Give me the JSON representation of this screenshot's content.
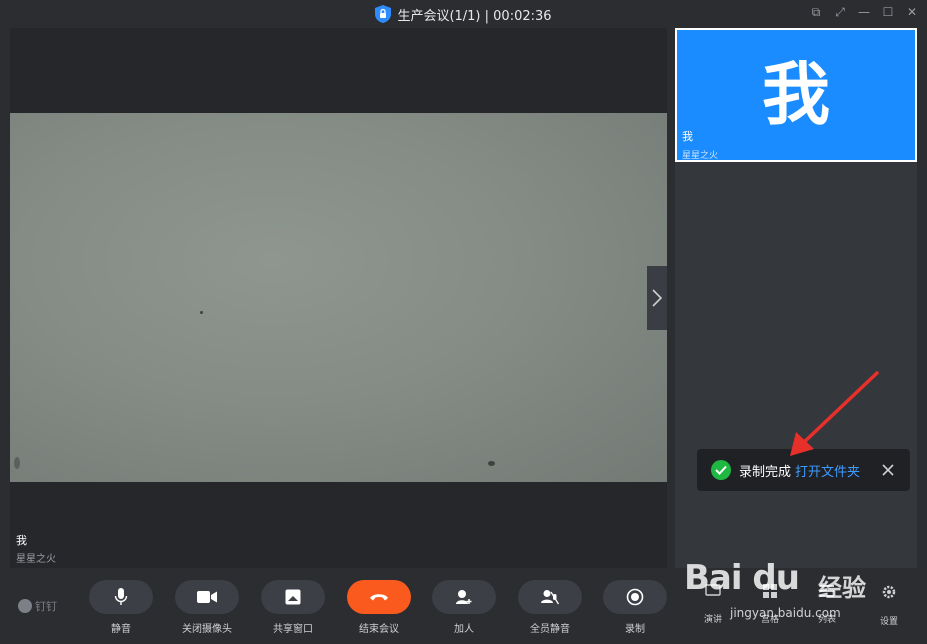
{
  "window": {
    "title": "生产会议(1/1) | 00:02:36",
    "controls": [
      "⧉",
      "⤢",
      "—",
      "☐",
      "✕"
    ]
  },
  "main_video": {
    "participant_name": "我",
    "participant_sub": "星星之火"
  },
  "side_panel": {
    "tile_avatar_text": "我",
    "tile_name": "我",
    "tile_sub": "星星之火"
  },
  "toast": {
    "message": "录制完成",
    "link": "打开文件夹"
  },
  "brand": {
    "label": "钉钉"
  },
  "toolbar": {
    "mute": "静音",
    "camera_off": "关闭摄像头",
    "share_window": "共享窗口",
    "end_meeting": "结束会议",
    "add_person": "加人",
    "mute_all": "全员静音",
    "record": "录制",
    "present": "演讲",
    "grid": "宫格",
    "list": "列表",
    "settings": "设置"
  },
  "watermark": {
    "brand": "Bai du",
    "cn": "经验",
    "url": "jingyan.baidu.com"
  },
  "colors": {
    "accent": "#1a8cff",
    "end_call": "#fa5a1e",
    "success": "#1fb842",
    "link": "#3e9bff"
  },
  "icons": {
    "title": "shield-lock-icon",
    "mute": "microphone-icon",
    "camera": "video-camera-icon",
    "share": "share-screen-icon",
    "end": "hang-up-icon",
    "add": "add-person-icon",
    "mute_all": "mute-all-icon",
    "record": "record-icon",
    "settings": "gear-icon"
  }
}
